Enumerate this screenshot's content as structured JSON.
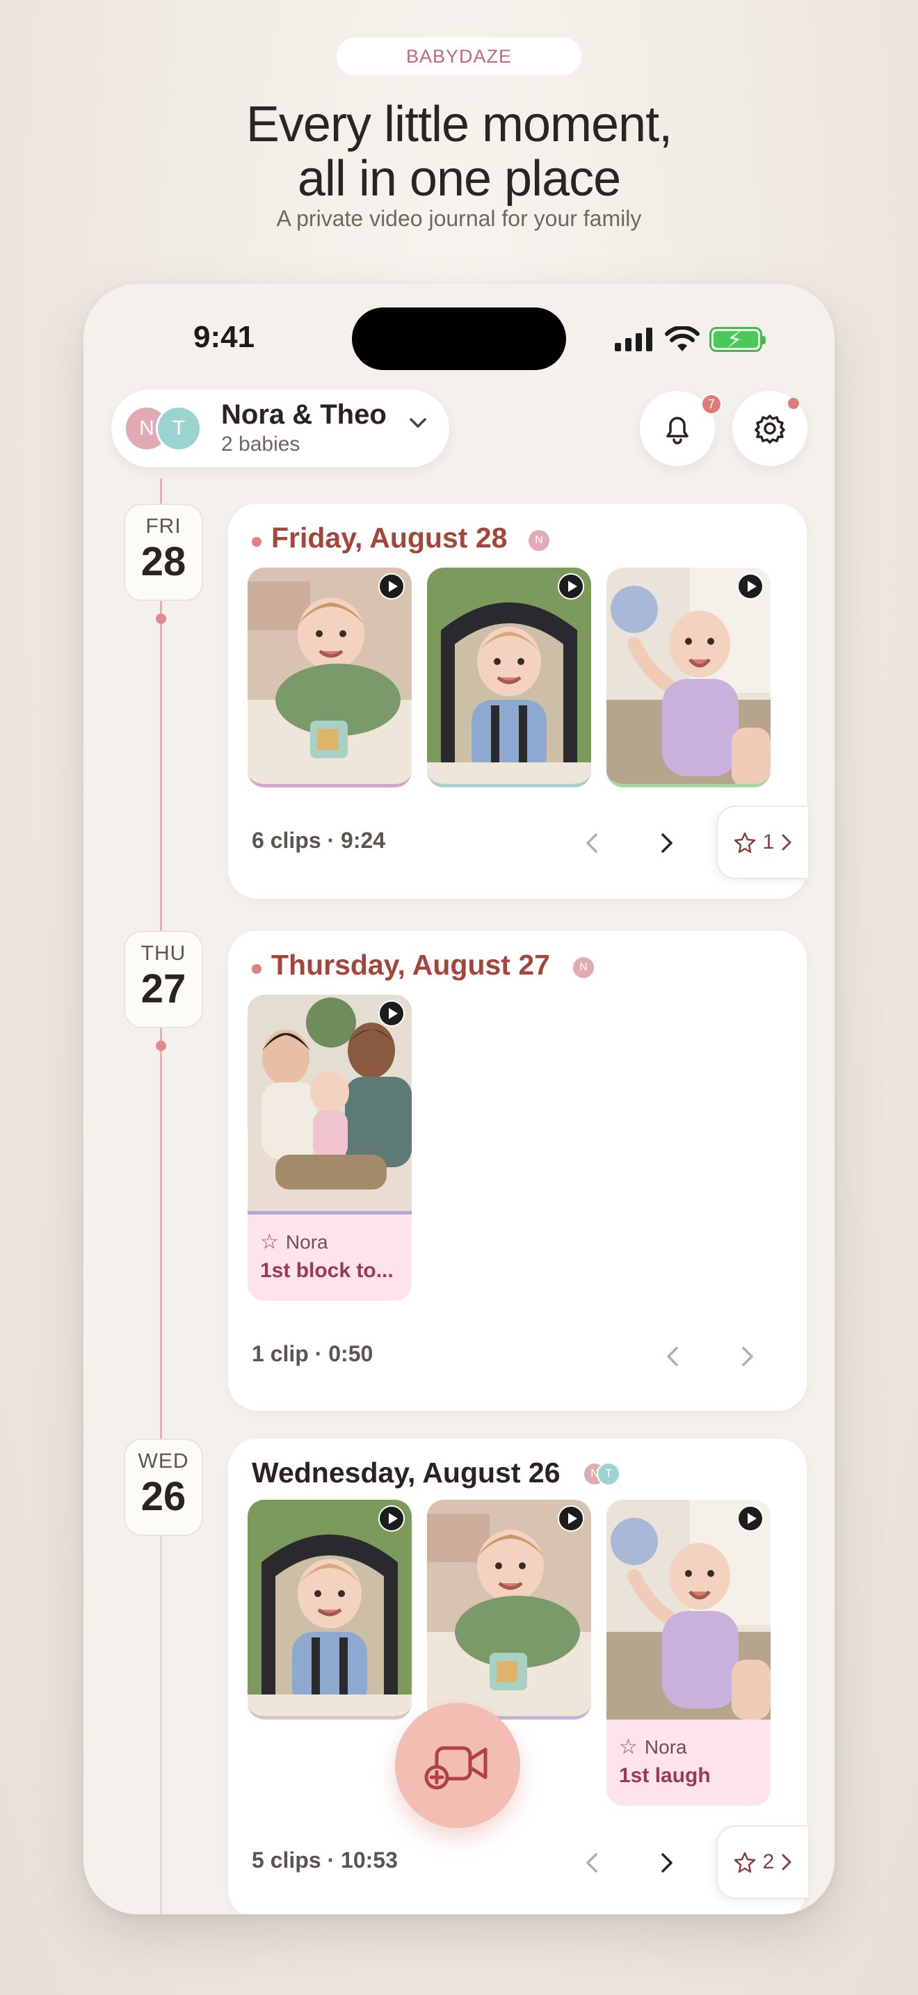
{
  "brand": "BABYDAZE",
  "headline": {
    "line1": "Every little moment,",
    "line2": "all in one place"
  },
  "subheadline": "A private video journal for your family",
  "status_bar": {
    "time": "9:41"
  },
  "header": {
    "profile_name": "Nora & Theo",
    "profile_count": "2 babies",
    "avatars": [
      "N",
      "T"
    ],
    "notification_count": "7"
  },
  "days": [
    {
      "dow": "FRI",
      "day": "28",
      "title": "Friday, August 28",
      "avatars": [
        "N"
      ],
      "clips_meta": "6 clips · 9:24",
      "favorites_count": "1"
    },
    {
      "dow": "THU",
      "day": "27",
      "title": "Thursday, August 27",
      "avatars": [
        "N"
      ],
      "clips_meta": "1 clip · 0:50",
      "tagged_clip": {
        "baby": "Nora",
        "title": "1st block to..."
      }
    },
    {
      "dow": "WED",
      "day": "26",
      "title": "Wednesday, August 26",
      "avatars": [
        "N",
        "T"
      ],
      "clips_meta": "5 clips · 10:53",
      "favorites_count": "2",
      "tagged_clip": {
        "baby": "Nora",
        "title": "1st laugh"
      }
    }
  ],
  "icons": {
    "bell": "bell-icon",
    "gear": "gear-icon",
    "chevron": "chevron-down-icon",
    "play": "play-icon",
    "star": "star-icon",
    "record": "video-add-icon"
  },
  "colors": {
    "accent": "#a4453b",
    "brand": "#c4667e",
    "fab": "#f2bdb3",
    "tag_bg": "#fce3ec"
  }
}
